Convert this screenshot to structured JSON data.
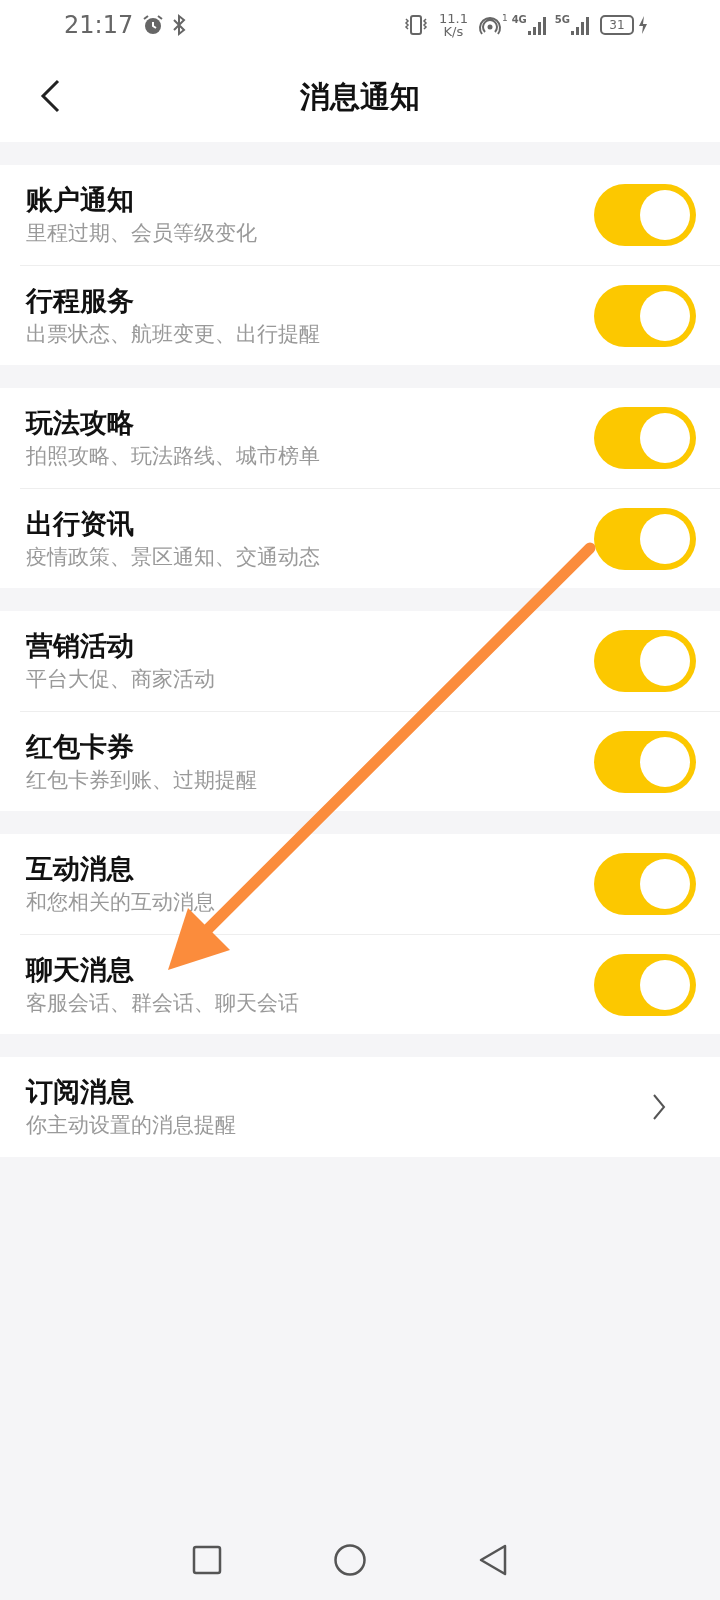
{
  "status_bar": {
    "time": "21:17",
    "speed": "11.1",
    "speed_unit": "K/s",
    "wifi_badge": "1",
    "network_1": "4G",
    "network_2": "5G",
    "battery": "31"
  },
  "header": {
    "title": "消息通知"
  },
  "groups": [
    {
      "items": [
        {
          "kind": "toggle",
          "title": "账户通知",
          "subtitle": "里程过期、会员等级变化",
          "on": true
        },
        {
          "kind": "toggle",
          "title": "行程服务",
          "subtitle": "出票状态、航班变更、出行提醒",
          "on": true
        }
      ]
    },
    {
      "items": [
        {
          "kind": "toggle",
          "title": "玩法攻略",
          "subtitle": "拍照攻略、玩法路线、城市榜单",
          "on": true
        },
        {
          "kind": "toggle",
          "title": "出行资讯",
          "subtitle": "疫情政策、景区通知、交通动态",
          "on": true
        }
      ]
    },
    {
      "items": [
        {
          "kind": "toggle",
          "title": "营销活动",
          "subtitle": "平台大促、商家活动",
          "on": true
        },
        {
          "kind": "toggle",
          "title": "红包卡券",
          "subtitle": "红包卡券到账、过期提醒",
          "on": true
        }
      ]
    },
    {
      "items": [
        {
          "kind": "toggle",
          "title": "互动消息",
          "subtitle": "和您相关的互动消息",
          "on": true
        },
        {
          "kind": "toggle",
          "title": "聊天消息",
          "subtitle": "客服会话、群会话、聊天会话",
          "on": true
        }
      ]
    },
    {
      "items": [
        {
          "kind": "link",
          "title": "订阅消息",
          "subtitle": "你主动设置的消息提醒"
        }
      ]
    }
  ]
}
